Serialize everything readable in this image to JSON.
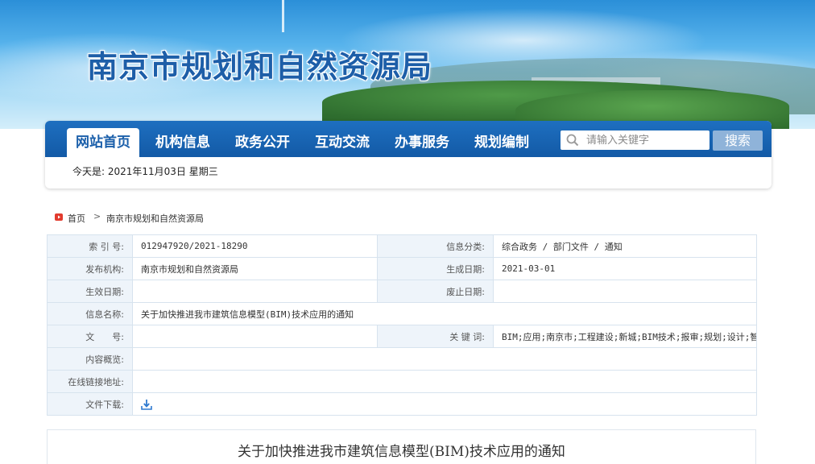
{
  "site": {
    "title": "南京市规划和自然资源局"
  },
  "nav": {
    "items": [
      {
        "label": "网站首页",
        "active": true
      },
      {
        "label": "机构信息",
        "active": false
      },
      {
        "label": "政务公开",
        "active": false
      },
      {
        "label": "互动交流",
        "active": false
      },
      {
        "label": "办事服务",
        "active": false
      },
      {
        "label": "规划编制",
        "active": false
      }
    ],
    "search_placeholder": "请输入关键字",
    "search_button": "搜索"
  },
  "today": {
    "text": "今天是: 2021年11月03日 星期三"
  },
  "breadcrumb": {
    "home": "首页",
    "separator": ">",
    "current": "南京市规划和自然资源局"
  },
  "info": {
    "index_label": "索 引 号:",
    "index_value": "012947920/2021-18290",
    "category_label": "信息分类:",
    "category_value": "综合政务 / 部门文件 / 通知",
    "publisher_label": "发布机构:",
    "publisher_value": "南京市规划和自然资源局",
    "created_label": "生成日期:",
    "created_value": "2021-03-01",
    "effective_label": "生效日期:",
    "effective_value": "",
    "abolished_label": "废止日期:",
    "abolished_value": "",
    "name_label": "信息名称:",
    "name_value": "关于加快推进我市建筑信息模型(BIM)技术应用的通知",
    "docno_label": "文　　号:",
    "docno_value": "",
    "keywords_label": "关 键 词:",
    "keywords_value": "BIM;应用;南京市;工程建设;新城;BIM技术;报审;规划;设计;智能",
    "summary_label": "内容概览:",
    "summary_value": "",
    "link_label": "在线链接地址:",
    "link_value": "",
    "download_label": "文件下载:"
  },
  "article": {
    "title": "关于加快推进我市建筑信息模型(BIM)技术应用的通知"
  },
  "colors": {
    "nav_blue": "#1b5faa",
    "label_bg": "#eef4fa",
    "title_blue": "#1d5ea8"
  }
}
